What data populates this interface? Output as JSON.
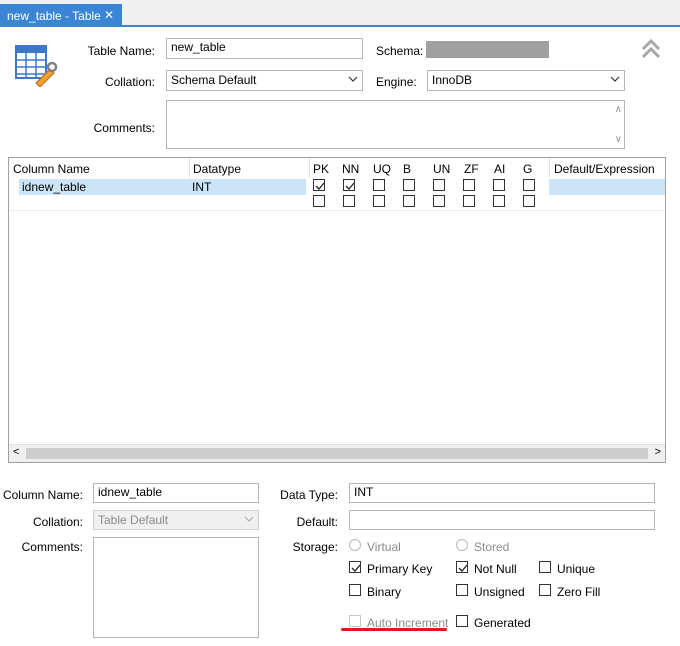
{
  "tab": {
    "label": "new_table - Table",
    "close_glyph": "✕"
  },
  "table_form": {
    "table_name_label": "Table Name:",
    "table_name_value": "new_table",
    "schema_label": "Schema:",
    "collation_label": "Collation:",
    "collation_value": "Schema Default",
    "engine_label": "Engine:",
    "engine_value": "InnoDB",
    "comments_label": "Comments:",
    "collapse_icon": "chevron-double-up-icon"
  },
  "grid": {
    "headers": [
      "Column Name",
      "Datatype",
      "PK",
      "NN",
      "UQ",
      "B",
      "UN",
      "ZF",
      "AI",
      "G",
      "Default/Expression"
    ],
    "rows": [
      {
        "name": "idnew_table",
        "datatype": "INT",
        "flags": [
          true,
          true,
          false,
          false,
          false,
          false,
          false,
          false
        ],
        "default": ""
      },
      {
        "name": "",
        "datatype": "",
        "flags": [
          false,
          false,
          false,
          false,
          false,
          false,
          false,
          false
        ],
        "default": ""
      }
    ],
    "scroll_left": "<",
    "scroll_right": ">"
  },
  "column_details": {
    "column_name_label": "Column Name:",
    "column_name_value": "idnew_table",
    "data_type_label": "Data Type:",
    "data_type_value": "INT",
    "collation_label": "Collation:",
    "collation_value": "Table Default",
    "default_label": "Default:",
    "default_value": "",
    "comments_label": "Comments:",
    "storage_label": "Storage:",
    "storage_options": [
      {
        "label": "Virtual",
        "selected": false,
        "enabled": false
      },
      {
        "label": "Stored",
        "selected": false,
        "enabled": false
      }
    ],
    "flags": {
      "primary_key": {
        "label": "Primary Key",
        "checked": true
      },
      "not_null": {
        "label": "Not Null",
        "checked": true
      },
      "unique": {
        "label": "Unique",
        "checked": false
      },
      "binary": {
        "label": "Binary",
        "checked": false
      },
      "unsigned": {
        "label": "Unsigned",
        "checked": false
      },
      "zero_fill": {
        "label": "Zero Fill",
        "checked": false
      },
      "auto_increment": {
        "label": "Auto Increment",
        "checked": false,
        "enabled": false
      },
      "generated": {
        "label": "Generated",
        "checked": false
      }
    }
  },
  "colors": {
    "accent": "#3a86d4",
    "selection": "#cce4f7",
    "highlight_underline": "#e3171b"
  }
}
